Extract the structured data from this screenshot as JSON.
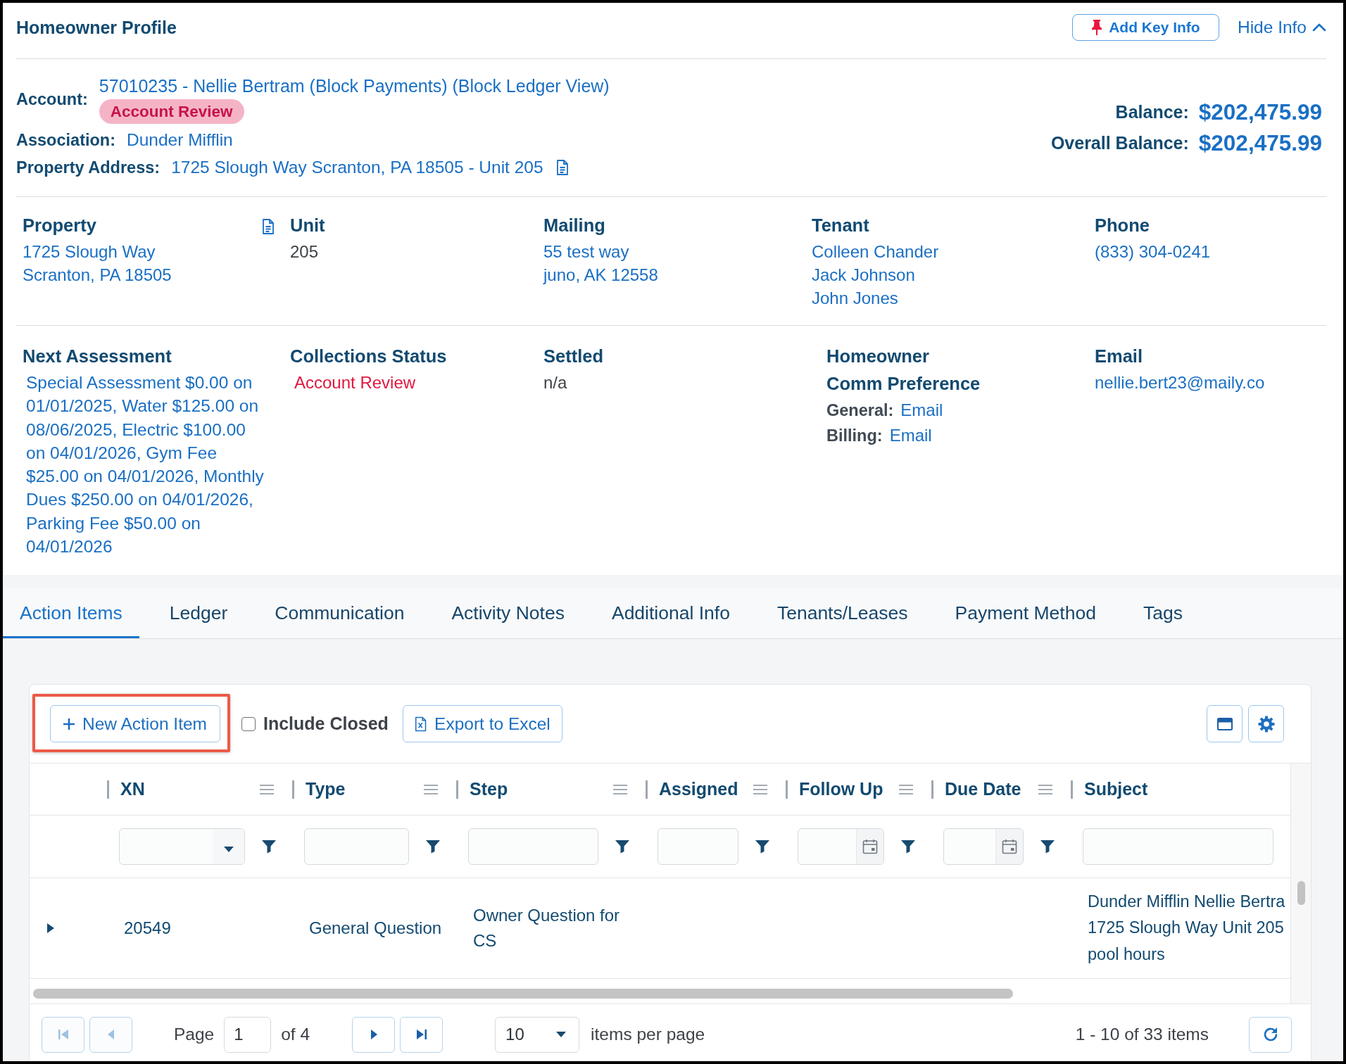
{
  "profile": {
    "title": "Homeowner Profile",
    "add_key_info": "Add Key Info",
    "toggle": {
      "label": "Hide Info",
      "expanded": true
    }
  },
  "account": {
    "label": "Account:",
    "value": "57010235 - Nellie Bertram (Block Payments) (Block Ledger View)",
    "badge": "Account Review"
  },
  "association": {
    "label": "Association:",
    "value": "Dunder Mifflin"
  },
  "property_address": {
    "label": "Property Address:",
    "value": "1725 Slough Way Scranton, PA 18505 - Unit 205"
  },
  "balances": [
    {
      "label": "Balance:",
      "value": "$202,475.99"
    },
    {
      "label": "Overall Balance:",
      "value": "$202,475.99"
    }
  ],
  "property_info": [
    {
      "heading": "Property",
      "kind": "address",
      "lines": [
        "1725 Slough Way",
        "Scranton, PA 18505"
      ]
    },
    {
      "heading": "Unit",
      "kind": "text",
      "lines": [
        "205"
      ]
    },
    {
      "heading": "Mailing",
      "kind": "link",
      "lines": [
        "55 test way",
        "juno, AK 12558"
      ]
    },
    {
      "heading": "Tenant",
      "kind": "link",
      "lines": [
        "Colleen Chander",
        "Jack Johnson",
        "John Jones"
      ]
    },
    {
      "heading": "Phone",
      "kind": "link",
      "lines": [
        "(833) 304-0241"
      ]
    }
  ],
  "account_info": [
    {
      "heading": "Next Assessment",
      "kind": "paragraph",
      "text": "Special Assessment $0.00 on 01/01/2025, Water $125.00 on 08/06/2025, Electric $100.00 on 04/01/2026, Gym Fee $25.00 on 04/01/2026, Monthly Dues $250.00 on 04/01/2026, Parking Fee $50.00 on 04/01/2026"
    },
    {
      "heading": "Collections Status",
      "kind": "alert",
      "lines": [
        "Account Review"
      ]
    },
    {
      "heading": "Settled",
      "kind": "text",
      "lines": [
        "n/a"
      ]
    },
    {
      "heading": "Homeowner",
      "subheading": "Comm Preference",
      "kind": "prefs",
      "items": [
        {
          "label": "General:",
          "value": "Email"
        },
        {
          "label": "Billing:",
          "value": "Email"
        }
      ]
    },
    {
      "heading": "Email",
      "kind": "link",
      "lines": [
        "nellie.bert23@maily.co"
      ]
    }
  ],
  "tabs": [
    {
      "label": "Action Items",
      "selected": true
    },
    {
      "label": "Ledger",
      "selected": false
    },
    {
      "label": "Communication",
      "selected": false
    },
    {
      "label": "Activity Notes",
      "selected": false
    },
    {
      "label": "Additional Info",
      "selected": false
    },
    {
      "label": "Tenants/Leases",
      "selected": false
    },
    {
      "label": "Payment Method",
      "selected": false
    },
    {
      "label": "Tags",
      "selected": false
    }
  ],
  "toolbar": {
    "new_item": {
      "label": "New Action Item",
      "highlighted": true
    },
    "include_closed": {
      "label": "Include Closed",
      "checked": false
    },
    "export": "Export to Excel"
  },
  "grid": {
    "columns": [
      {
        "label": "XN",
        "kind": "dropdown",
        "controls_shown": true
      },
      {
        "label": "Type",
        "kind": "text",
        "controls_shown": true
      },
      {
        "label": "Step",
        "kind": "text",
        "controls_shown": true
      },
      {
        "label": "Assigned",
        "kind": "text",
        "controls_shown": true
      },
      {
        "label": "Follow Up",
        "kind": "date",
        "controls_shown": true
      },
      {
        "label": "Due Date",
        "kind": "date",
        "controls_shown": true
      },
      {
        "label": "Subject",
        "kind": "text",
        "controls_shown": false
      }
    ],
    "rows": [
      {
        "expanded": false,
        "cells": [
          "20549",
          "General Question",
          "Owner Question for CS",
          null,
          null,
          null,
          [
            "Dunder Mifflin Nellie Bertra",
            "1725 Slough Way Unit 205",
            "pool hours"
          ]
        ]
      }
    ]
  },
  "pager": {
    "first_disabled": true,
    "prev_disabled": true,
    "page_label": "Page",
    "page": "1",
    "page_count": "of 4",
    "next_disabled": false,
    "last_disabled": false,
    "page_size": "10",
    "page_size_label": "items per page",
    "summary": "1 - 10 of 33 items"
  }
}
